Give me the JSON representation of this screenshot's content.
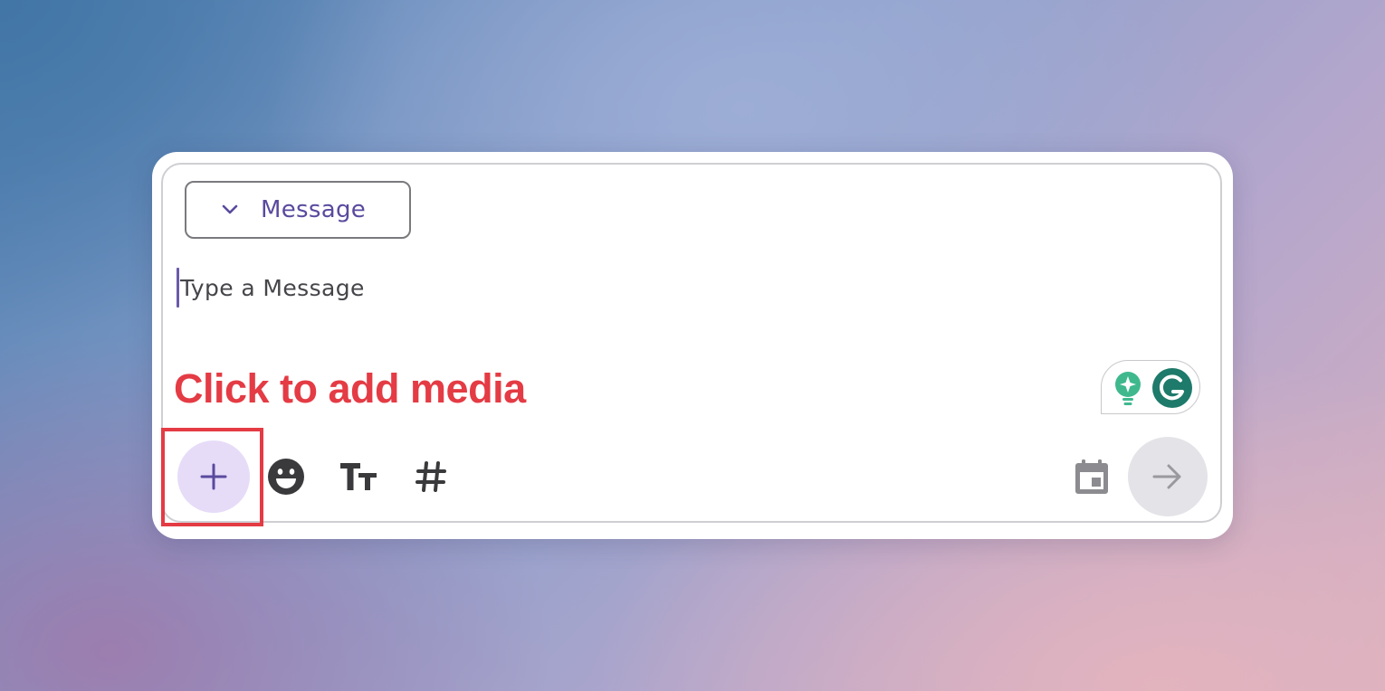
{
  "composer": {
    "type_dropdown": {
      "label": "Message",
      "icon": "chevron-down-icon"
    },
    "message_input": {
      "placeholder": "Type a Message",
      "value": ""
    }
  },
  "annotation": {
    "text": "Click to add media",
    "color": "#e43b44"
  },
  "toolbar": {
    "add_media": {
      "icon": "plus-icon"
    },
    "emoji": {
      "icon": "emoji-icon"
    },
    "text_format": {
      "icon": "text-format-icon"
    },
    "hashtag": {
      "icon": "hashtag-icon"
    },
    "schedule": {
      "icon": "calendar-icon"
    },
    "send": {
      "icon": "arrow-right-icon"
    }
  },
  "grammarly": {
    "icons": [
      "lightbulb-sparkle-icon",
      "grammarly-g-icon"
    ]
  },
  "colors": {
    "accent": "#5a4a9e",
    "add_button_bg": "#e6dcf8",
    "grammarly_green": "#1e7a6a",
    "grammarly_teal": "#3fb88e"
  }
}
